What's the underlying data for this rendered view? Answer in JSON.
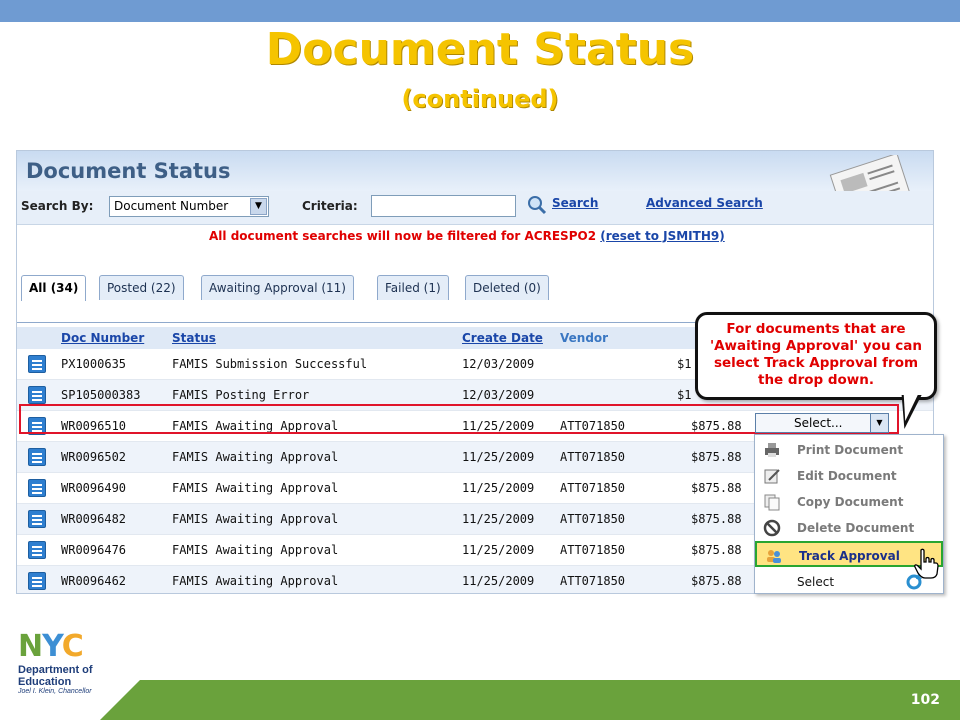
{
  "slide": {
    "title": "Document Status",
    "subtitle": "(continued)",
    "page_number": "102"
  },
  "app": {
    "title": "Document Status",
    "search_by_label": "Search By:",
    "search_by_value": "Document Number",
    "criteria_label": "Criteria:",
    "criteria_value": "",
    "search_link": "Search",
    "advanced_search_link": "Advanced Search",
    "filter_message": "All document searches will now be filtered for ACRESPO2",
    "reset_link": "(reset to JSMITH9)"
  },
  "tabs": [
    {
      "label": "All (34)",
      "active": true
    },
    {
      "label": "Posted (22)",
      "active": false
    },
    {
      "label": "Awaiting Approval (11)",
      "active": false
    },
    {
      "label": "Failed (1)",
      "active": false
    },
    {
      "label": "Deleted (0)",
      "active": false
    }
  ],
  "table": {
    "columns": {
      "doc_number": "Doc Number",
      "status": "Status",
      "create_date": "Create Date",
      "vendor": "Vendor"
    },
    "rows": [
      {
        "doc": "PX1000635",
        "status": "FAMIS Submission Successful",
        "date": "12/03/2009",
        "vendor": "",
        "amount": "$1"
      },
      {
        "doc": "SP105000383",
        "status": "FAMIS Posting Error",
        "date": "12/03/2009",
        "vendor": "",
        "amount": "$1"
      },
      {
        "doc": "WR0096510",
        "status": "FAMIS Awaiting Approval",
        "date": "11/25/2009",
        "vendor": "ATT071850",
        "amount": "$875.88"
      },
      {
        "doc": "WR0096502",
        "status": "FAMIS Awaiting Approval",
        "date": "11/25/2009",
        "vendor": "ATT071850",
        "amount": "$875.88"
      },
      {
        "doc": "WR0096490",
        "status": "FAMIS Awaiting Approval",
        "date": "11/25/2009",
        "vendor": "ATT071850",
        "amount": "$875.88"
      },
      {
        "doc": "WR0096482",
        "status": "FAMIS Awaiting Approval",
        "date": "11/25/2009",
        "vendor": "ATT071850",
        "amount": "$875.88"
      },
      {
        "doc": "WR0096476",
        "status": "FAMIS Awaiting Approval",
        "date": "11/25/2009",
        "vendor": "ATT071850",
        "amount": "$875.88"
      },
      {
        "doc": "WR0096462",
        "status": "FAMIS Awaiting Approval",
        "date": "11/25/2009",
        "vendor": "ATT071850",
        "amount": "$875.88"
      }
    ]
  },
  "dropdown": {
    "selected": "Select...",
    "items": [
      {
        "label": "Print Document",
        "icon": "printer-icon"
      },
      {
        "label": "Edit Document",
        "icon": "edit-icon"
      },
      {
        "label": "Copy Document",
        "icon": "copy-icon"
      },
      {
        "label": "Delete Document",
        "icon": "delete-icon"
      },
      {
        "label": "Track Approval",
        "icon": "users-icon",
        "highlighted": true
      },
      {
        "label": "Select",
        "icon": "refresh-icon"
      }
    ]
  },
  "callout": {
    "text": "For documents that are 'Awaiting Approval' you can select Track Approval from the drop down."
  },
  "logo": {
    "letters": [
      "N",
      "Y",
      "C"
    ],
    "line1": "Department of",
    "line2": "Education",
    "line3": "Joel I. Klein, Chancellor"
  },
  "colors": {
    "title": "#f5c400",
    "top_bar": "#6f9bd2",
    "footer": "#6aa23c",
    "highlight_red": "#e0142a",
    "link_blue": "#1a46a8"
  }
}
